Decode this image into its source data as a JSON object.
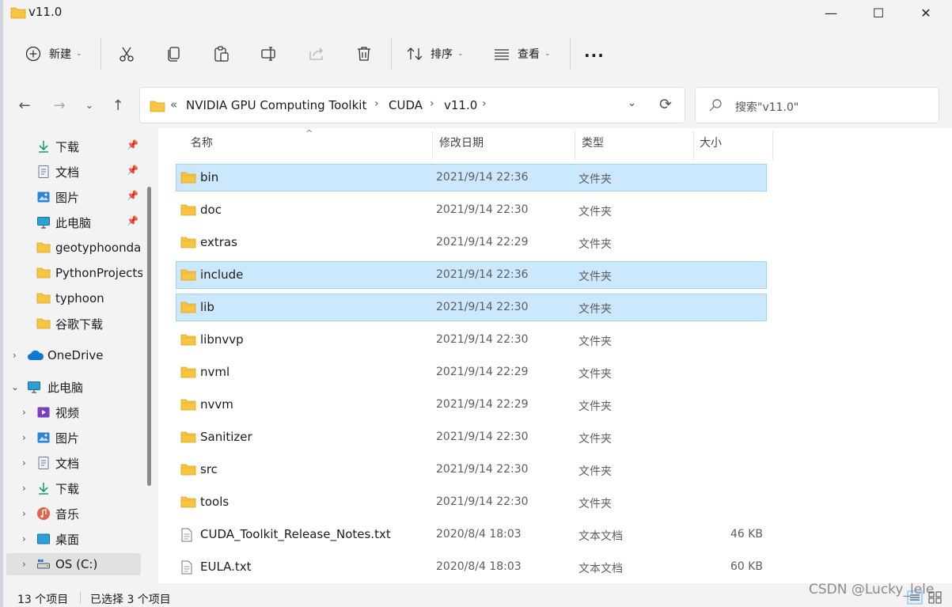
{
  "window": {
    "title": "v11.0",
    "controls": {
      "minimize": "—",
      "maximize": "☐",
      "close": "✕"
    }
  },
  "toolbar": {
    "new_label": "新建",
    "sort_label": "排序",
    "view_label": "查看",
    "more_label": "···",
    "icons": [
      "plus-circle-icon",
      "cut-icon",
      "copy-icon",
      "paste-icon",
      "rename-icon",
      "share-icon",
      "delete-icon",
      "sort-icon",
      "view-icon"
    ]
  },
  "address": {
    "overflow": "«",
    "crumbs": [
      "NVIDIA GPU Computing Toolkit",
      "CUDA",
      "v11.0"
    ],
    "separator": "›"
  },
  "search": {
    "placeholder": "搜索\"v11.0\""
  },
  "sidebar": {
    "quick_access": [
      {
        "label": "下载",
        "icon": "download-icon",
        "pinned": true
      },
      {
        "label": "文档",
        "icon": "document-icon",
        "pinned": true
      },
      {
        "label": "图片",
        "icon": "picture-icon",
        "pinned": true
      },
      {
        "label": "此电脑",
        "icon": "computer-icon",
        "pinned": true
      },
      {
        "label": "geotyphoonda",
        "icon": "folder-icon",
        "pinned": false
      },
      {
        "label": "PythonProjects",
        "icon": "folder-icon",
        "pinned": false
      },
      {
        "label": "typhoon",
        "icon": "folder-icon",
        "pinned": false
      },
      {
        "label": "谷歌下载",
        "icon": "folder-icon",
        "pinned": false
      }
    ],
    "onedrive": {
      "label": "OneDrive",
      "icon": "cloud-icon"
    },
    "this_pc": {
      "label": "此电脑",
      "icon": "computer-icon"
    },
    "pc_children": [
      {
        "label": "视频",
        "icon": "video-icon"
      },
      {
        "label": "图片",
        "icon": "picture-icon"
      },
      {
        "label": "文档",
        "icon": "document-icon"
      },
      {
        "label": "下载",
        "icon": "download-icon"
      },
      {
        "label": "音乐",
        "icon": "music-icon"
      },
      {
        "label": "桌面",
        "icon": "desktop-icon"
      },
      {
        "label": "OS (C:)",
        "icon": "drive-icon"
      }
    ]
  },
  "columns": {
    "name": "名称",
    "date": "修改日期",
    "type": "类型",
    "size": "大小"
  },
  "files": [
    {
      "name": "bin",
      "date": "2021/9/14 22:36",
      "type": "文件夹",
      "size": "",
      "kind": "folder",
      "selected": true
    },
    {
      "name": "doc",
      "date": "2021/9/14 22:30",
      "type": "文件夹",
      "size": "",
      "kind": "folder",
      "selected": false
    },
    {
      "name": "extras",
      "date": "2021/9/14 22:29",
      "type": "文件夹",
      "size": "",
      "kind": "folder",
      "selected": false
    },
    {
      "name": "include",
      "date": "2021/9/14 22:36",
      "type": "文件夹",
      "size": "",
      "kind": "folder",
      "selected": true
    },
    {
      "name": "lib",
      "date": "2021/9/14 22:30",
      "type": "文件夹",
      "size": "",
      "kind": "folder",
      "selected": true
    },
    {
      "name": "libnvvp",
      "date": "2021/9/14 22:30",
      "type": "文件夹",
      "size": "",
      "kind": "folder",
      "selected": false
    },
    {
      "name": "nvml",
      "date": "2021/9/14 22:29",
      "type": "文件夹",
      "size": "",
      "kind": "folder",
      "selected": false
    },
    {
      "name": "nvvm",
      "date": "2021/9/14 22:29",
      "type": "文件夹",
      "size": "",
      "kind": "folder",
      "selected": false
    },
    {
      "name": "Sanitizer",
      "date": "2021/9/14 22:30",
      "type": "文件夹",
      "size": "",
      "kind": "folder",
      "selected": false
    },
    {
      "name": "src",
      "date": "2021/9/14 22:30",
      "type": "文件夹",
      "size": "",
      "kind": "folder",
      "selected": false
    },
    {
      "name": "tools",
      "date": "2021/9/14 22:30",
      "type": "文件夹",
      "size": "",
      "kind": "folder",
      "selected": false
    },
    {
      "name": "CUDA_Toolkit_Release_Notes.txt",
      "date": "2020/8/4 18:03",
      "type": "文本文档",
      "size": "46 KB",
      "kind": "text",
      "selected": false
    },
    {
      "name": "EULA.txt",
      "date": "2020/8/4 18:03",
      "type": "文本文档",
      "size": "60 KB",
      "kind": "text",
      "selected": false
    }
  ],
  "status": {
    "count": "13 个项目",
    "selected": "已选择 3 个项目"
  },
  "watermark": "CSDN @Lucky_lele",
  "colors": {
    "selection": "#cce8ff",
    "selection_border": "#99d1ff",
    "folder": "#f8c542",
    "accent": "#0067c0"
  }
}
